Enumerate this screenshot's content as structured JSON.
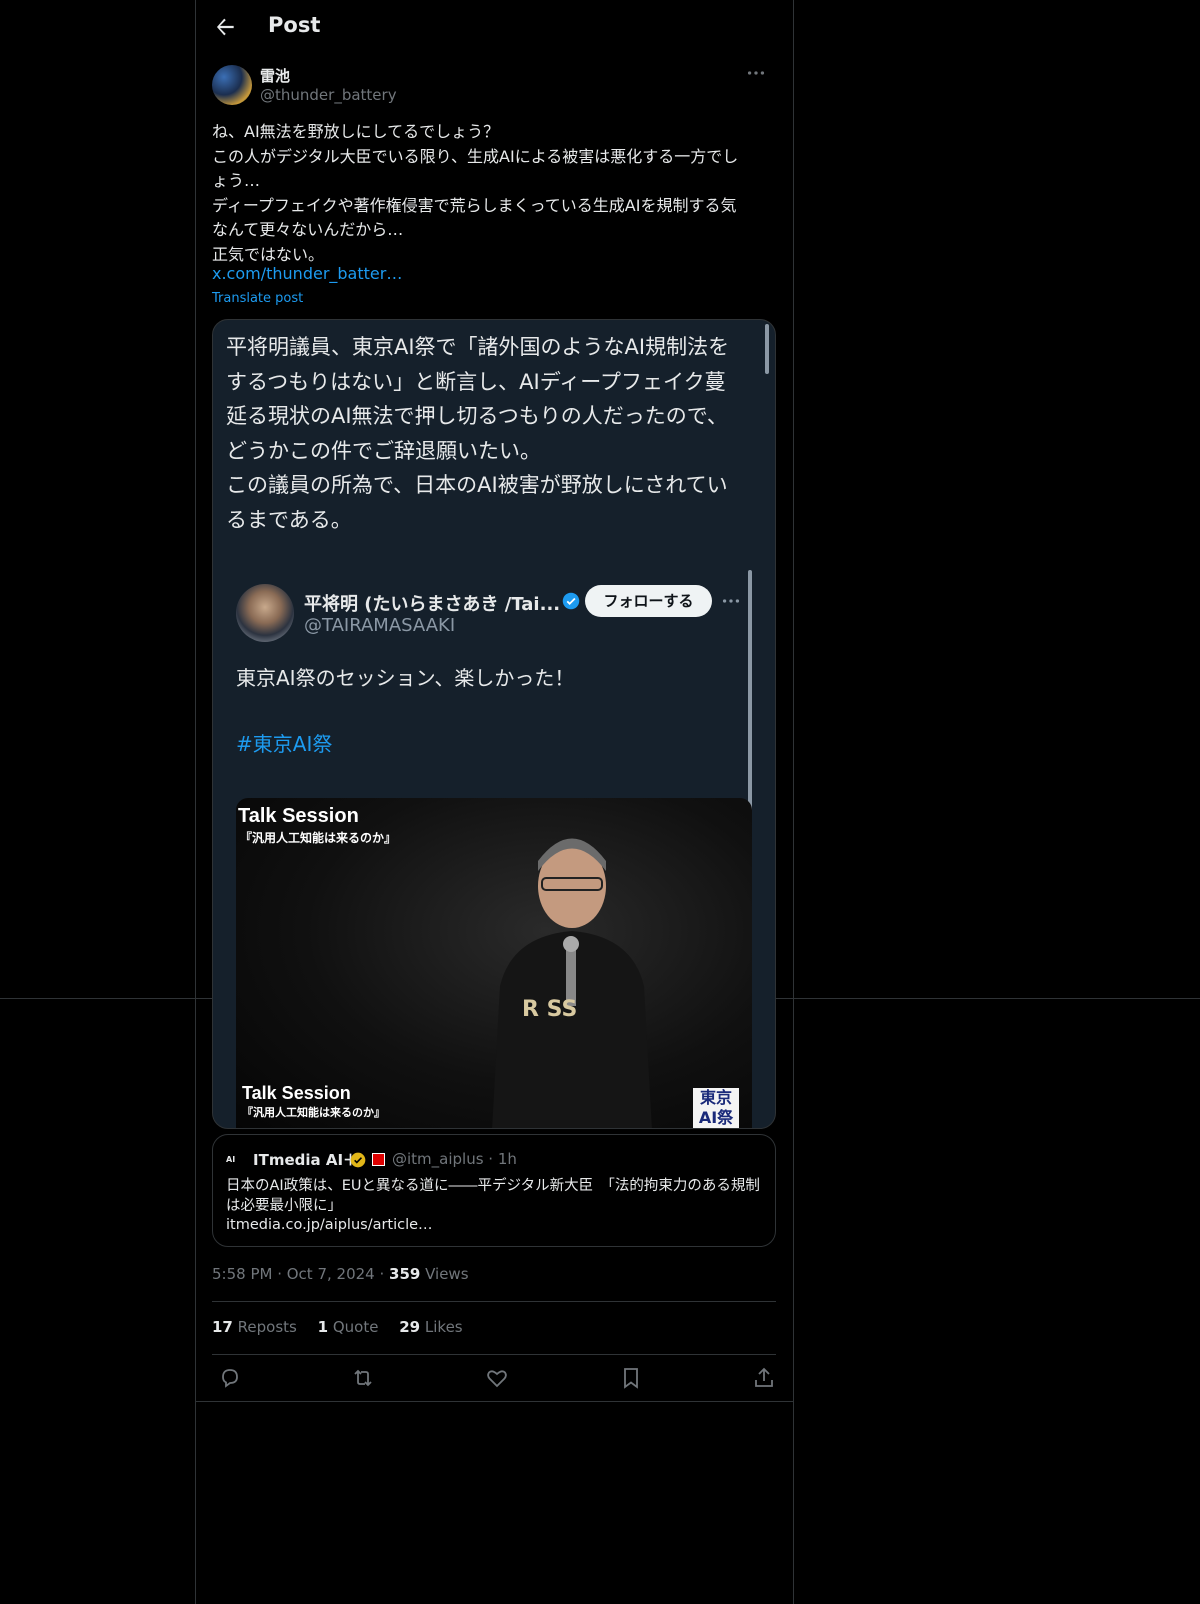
{
  "header": {
    "title": "Post"
  },
  "post": {
    "author": {
      "display_name": "雷池",
      "handle": "@thunder_battery"
    },
    "text_lines": [
      "ね、AI無法を野放しにしてるでしょう？",
      "この人がデジタル大臣でいる限り、生成AIによる被害は悪化する一方でし",
      "ょう…",
      "ディープフェイクや著作権侵害で荒らしまくっている生成AIを規制する気",
      "なんて更々ないんだから…",
      "正気ではない。"
    ],
    "link": "x.com/thunder_batter…",
    "translate_label": "Translate post"
  },
  "embed": {
    "text_lines": [
      "平将明議員、東京AI祭で「諸外国のようなAI規制法を",
      "するつもりはない」と断言し、AIディープフェイク蔓",
      "延る現状のAI無法で押し切るつもりの人だったので、",
      "どうかこの件でご辞退願いたい。",
      "この議員の所為で、日本のAI被害が野放しにされてい",
      "るまである。"
    ],
    "inner": {
      "name": "平将明 (たいらまさあき /Tai...",
      "handle": "@TAIRAMASAAKI",
      "follow_label": "フォローする",
      "text": "東京AI祭のセッション、楽しかった！",
      "hashtag": "#東京AI祭",
      "video": {
        "title": "Talk Session",
        "subtitle": "『汎用人工知能は来るのか』",
        "title2": "Talk Session",
        "subtitle2": "『汎用人工知能は来るのか』",
        "logo_text": "東京AI祭"
      }
    }
  },
  "quoted_card": {
    "logo": "AI",
    "name": "ITmedia AI＋",
    "handle": "@itm_aiplus · 1h",
    "text": "日本のAI政策は、EUと異なる道に――平デジタル新大臣　「法的拘束力のある規制は必要最小限に」",
    "link": "itmedia.co.jp/aiplus/article…"
  },
  "meta": {
    "time": "5:58 PM · Oct 7, 2024 · ",
    "views_count": "359",
    "views_label": " Views"
  },
  "stats": [
    {
      "count": "17",
      "label": "Reposts"
    },
    {
      "count": "1",
      "label": "Quote"
    },
    {
      "count": "29",
      "label": "Likes"
    }
  ],
  "icons": [
    "back-arrow-icon",
    "more-icon",
    "verified-icon",
    "reply-icon",
    "repost-icon",
    "like-icon",
    "bookmark-icon",
    "share-icon"
  ],
  "colors": {
    "background": "#000000",
    "accent": "#1d9bf0",
    "embed_bg": "#15202b",
    "border": "#2f3336",
    "muted": "#71767b"
  }
}
